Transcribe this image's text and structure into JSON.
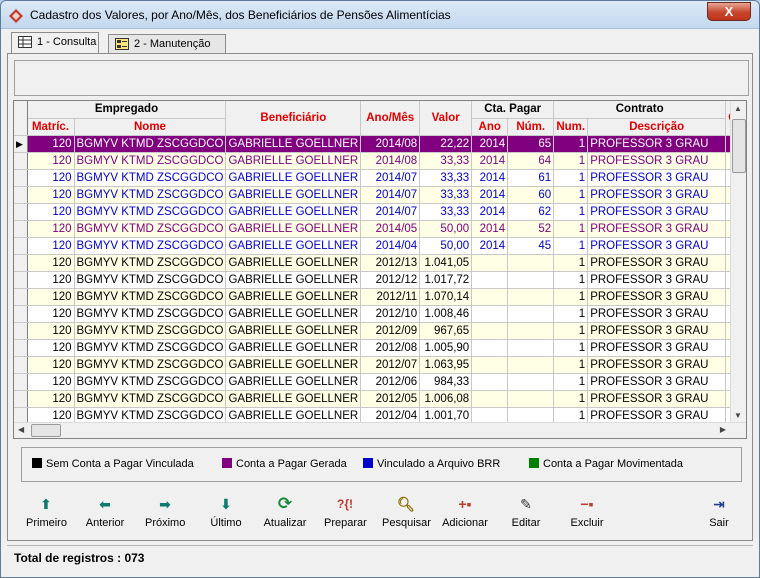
{
  "window": {
    "title": "Cadastro dos Valores, por Ano/Mês, dos Beneficiários de Pensões Alimentícias",
    "close_label": "X"
  },
  "tabs": [
    {
      "label": "1 - Consulta"
    },
    {
      "label": "2 - Manutenção"
    }
  ],
  "grid": {
    "group_headers": {
      "empregado": "Empregado",
      "cta_pagar": "Cta. Pagar",
      "contrato": "Contrato"
    },
    "headers": {
      "matric": "Matríc.",
      "nome": "Nome",
      "beneficiario": "Beneficiário",
      "ano_mes": "Ano/Mês",
      "valor": "Valor",
      "ano": "Ano",
      "num": "Núm.",
      "contrato_num": "Num.",
      "descricao": "Descrição",
      "extra": "C"
    },
    "rows": [
      {
        "matric": "120",
        "nome": "BGMYV KTMD ZSCGGDCO",
        "beneficiario": "GABRIELLE GOELLNER",
        "ano_mes": "2014/08",
        "valor": "22,22",
        "ano": "2014",
        "num": "65",
        "contrato_num": "1",
        "descricao": "PROFESSOR 3 GRAU"
      },
      {
        "matric": "120",
        "nome": "BGMYV KTMD ZSCGGDCO",
        "beneficiario": "GABRIELLE GOELLNER",
        "ano_mes": "2014/08",
        "valor": "33,33",
        "ano": "2014",
        "num": "64",
        "contrato_num": "1",
        "descricao": "PROFESSOR 3 GRAU"
      },
      {
        "matric": "120",
        "nome": "BGMYV KTMD ZSCGGDCO",
        "beneficiario": "GABRIELLE GOELLNER",
        "ano_mes": "2014/07",
        "valor": "33,33",
        "ano": "2014",
        "num": "61",
        "contrato_num": "1",
        "descricao": "PROFESSOR 3 GRAU"
      },
      {
        "matric": "120",
        "nome": "BGMYV KTMD ZSCGGDCO",
        "beneficiario": "GABRIELLE GOELLNER",
        "ano_mes": "2014/07",
        "valor": "33,33",
        "ano": "2014",
        "num": "60",
        "contrato_num": "1",
        "descricao": "PROFESSOR 3 GRAU"
      },
      {
        "matric": "120",
        "nome": "BGMYV KTMD ZSCGGDCO",
        "beneficiario": "GABRIELLE GOELLNER",
        "ano_mes": "2014/07",
        "valor": "33,33",
        "ano": "2014",
        "num": "62",
        "contrato_num": "1",
        "descricao": "PROFESSOR 3 GRAU"
      },
      {
        "matric": "120",
        "nome": "BGMYV KTMD ZSCGGDCO",
        "beneficiario": "GABRIELLE GOELLNER",
        "ano_mes": "2014/05",
        "valor": "50,00",
        "ano": "2014",
        "num": "52",
        "contrato_num": "1",
        "descricao": "PROFESSOR 3 GRAU"
      },
      {
        "matric": "120",
        "nome": "BGMYV KTMD ZSCGGDCO",
        "beneficiario": "GABRIELLE GOELLNER",
        "ano_mes": "2014/04",
        "valor": "50,00",
        "ano": "2014",
        "num": "45",
        "contrato_num": "1",
        "descricao": "PROFESSOR 3 GRAU"
      },
      {
        "matric": "120",
        "nome": "BGMYV KTMD ZSCGGDCO",
        "beneficiario": "GABRIELLE GOELLNER",
        "ano_mes": "2012/13",
        "valor": "1.041,05",
        "ano": "",
        "num": "",
        "contrato_num": "1",
        "descricao": "PROFESSOR 3 GRAU"
      },
      {
        "matric": "120",
        "nome": "BGMYV KTMD ZSCGGDCO",
        "beneficiario": "GABRIELLE GOELLNER",
        "ano_mes": "2012/12",
        "valor": "1.017,72",
        "ano": "",
        "num": "",
        "contrato_num": "1",
        "descricao": "PROFESSOR 3 GRAU"
      },
      {
        "matric": "120",
        "nome": "BGMYV KTMD ZSCGGDCO",
        "beneficiario": "GABRIELLE GOELLNER",
        "ano_mes": "2012/11",
        "valor": "1.070,14",
        "ano": "",
        "num": "",
        "contrato_num": "1",
        "descricao": "PROFESSOR 3 GRAU"
      },
      {
        "matric": "120",
        "nome": "BGMYV KTMD ZSCGGDCO",
        "beneficiario": "GABRIELLE GOELLNER",
        "ano_mes": "2012/10",
        "valor": "1.008,46",
        "ano": "",
        "num": "",
        "contrato_num": "1",
        "descricao": "PROFESSOR 3 GRAU"
      },
      {
        "matric": "120",
        "nome": "BGMYV KTMD ZSCGGDCO",
        "beneficiario": "GABRIELLE GOELLNER",
        "ano_mes": "2012/09",
        "valor": "967,65",
        "ano": "",
        "num": "",
        "contrato_num": "1",
        "descricao": "PROFESSOR 3 GRAU"
      },
      {
        "matric": "120",
        "nome": "BGMYV KTMD ZSCGGDCO",
        "beneficiario": "GABRIELLE GOELLNER",
        "ano_mes": "2012/08",
        "valor": "1.005,90",
        "ano": "",
        "num": "",
        "contrato_num": "1",
        "descricao": "PROFESSOR 3 GRAU"
      },
      {
        "matric": "120",
        "nome": "BGMYV KTMD ZSCGGDCO",
        "beneficiario": "GABRIELLE GOELLNER",
        "ano_mes": "2012/07",
        "valor": "1.063,95",
        "ano": "",
        "num": "",
        "contrato_num": "1",
        "descricao": "PROFESSOR 3 GRAU"
      },
      {
        "matric": "120",
        "nome": "BGMYV KTMD ZSCGGDCO",
        "beneficiario": "GABRIELLE GOELLNER",
        "ano_mes": "2012/06",
        "valor": "984,33",
        "ano": "",
        "num": "",
        "contrato_num": "1",
        "descricao": "PROFESSOR 3 GRAU"
      },
      {
        "matric": "120",
        "nome": "BGMYV KTMD ZSCGGDCO",
        "beneficiario": "GABRIELLE GOELLNER",
        "ano_mes": "2012/05",
        "valor": "1.006,08",
        "ano": "",
        "num": "",
        "contrato_num": "1",
        "descricao": "PROFESSOR 3 GRAU"
      },
      {
        "matric": "120",
        "nome": "BGMYV KTMD ZSCGGDCO",
        "beneficiario": "GABRIELLE GOELLNER",
        "ano_mes": "2012/04",
        "valor": "1.001,70",
        "ano": "",
        "num": "",
        "contrato_num": "1",
        "descricao": "PROFESSOR 3 GRAU"
      }
    ]
  },
  "legend": [
    {
      "label": "Sem Conta a Pagar Vinculada",
      "color": "#000000"
    },
    {
      "label": "Conta a Pagar Gerada",
      "color": "#800080"
    },
    {
      "label": "Vinculado a Arquivo BRR",
      "color": "#0000cc"
    },
    {
      "label": "Conta a Pagar Movimentada",
      "color": "#008000"
    }
  ],
  "toolbar": {
    "primeiro": "Primeiro",
    "anterior": "Anterior",
    "proximo": "Próximo",
    "ultimo": "Último",
    "atualizar": "Atualizar",
    "preparar": "Preparar",
    "pesquisar": "Pesquisar",
    "adicionar": "Adicionar",
    "editar": "Editar",
    "excluir": "Excluir",
    "sair": "Sair"
  },
  "status": {
    "total_label": "Total de registros : 073"
  }
}
